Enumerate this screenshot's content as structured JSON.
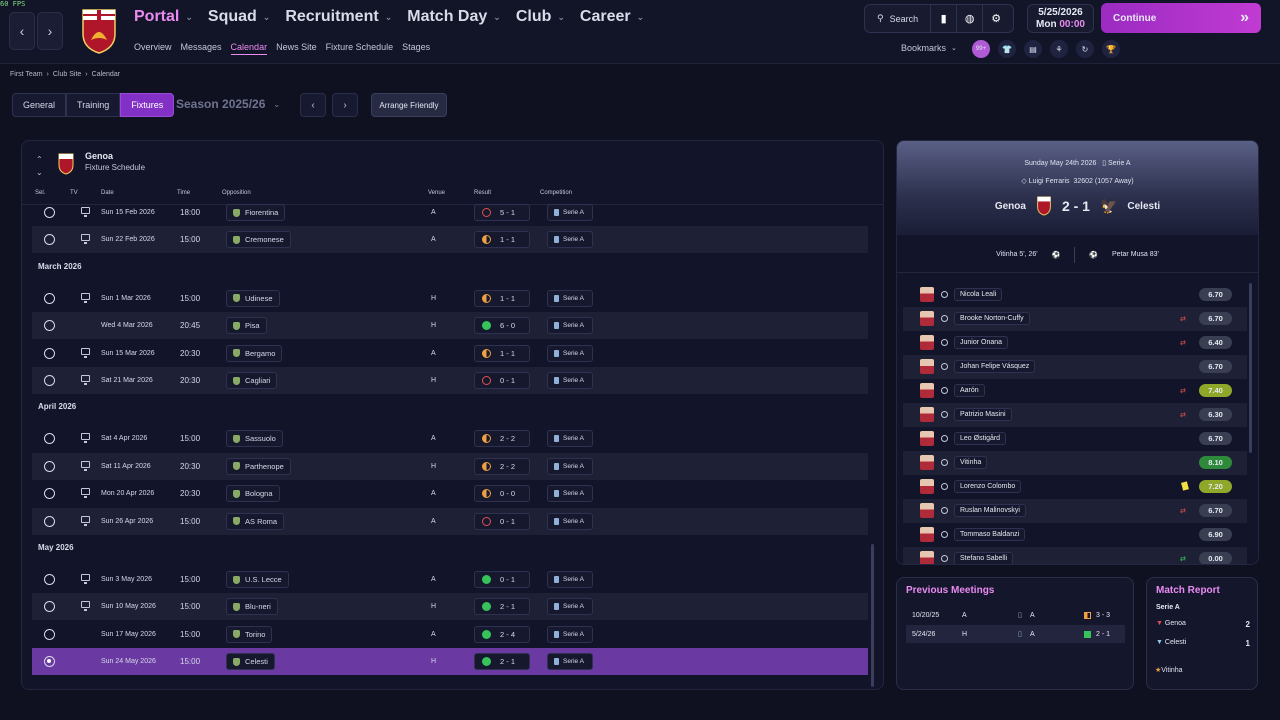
{
  "fps": "60 FPS",
  "nav": {
    "main": [
      "Portal",
      "Squad",
      "Recruitment",
      "Match Day",
      "Club",
      "Career"
    ],
    "sub": [
      "Overview",
      "Messages",
      "Calendar",
      "News Site",
      "Fixture Schedule",
      "Stages"
    ]
  },
  "tools": {
    "search": "Search"
  },
  "date": {
    "date": "5/25/2026",
    "day": "Mon",
    "time": "00:00"
  },
  "continue": "Continue",
  "bookmarks": "Bookmarks",
  "badge": "99+",
  "breadcrumb": [
    "First Team",
    "Club Site",
    "Calendar"
  ],
  "tabs": [
    "General",
    "Training",
    "Fixtures"
  ],
  "season": "Season 2025/26",
  "arrange": "Arrange Friendly",
  "schedule": {
    "club": "Genoa",
    "title": "Fixture Schedule",
    "columns": [
      "Sel.",
      "TV",
      "Date",
      "Time",
      "Opposition",
      "Venue",
      "Result",
      "Competition"
    ],
    "groups": [
      {
        "month": "",
        "rows": [
          {
            "date": "Sun 15 Feb 2026",
            "time": "18:00",
            "opp": "Fiorentina",
            "venue": "A",
            "result": "5 - 1",
            "dot": "L",
            "comp": "Serie A",
            "tv": true
          },
          {
            "date": "Sun 22 Feb 2026",
            "time": "15:00",
            "opp": "Cremonese",
            "venue": "A",
            "result": "1 - 1",
            "dot": "D",
            "comp": "Serie A",
            "tv": true
          }
        ]
      },
      {
        "month": "March 2026",
        "rows": [
          {
            "date": "Sun 1 Mar 2026",
            "time": "15:00",
            "opp": "Udinese",
            "venue": "H",
            "result": "1 - 1",
            "dot": "D",
            "comp": "Serie A",
            "tv": true
          },
          {
            "date": "Wed 4 Mar 2026",
            "time": "20:45",
            "opp": "Pisa",
            "venue": "H",
            "result": "6 - 0",
            "dot": "W",
            "comp": "Serie A",
            "tv": false
          },
          {
            "date": "Sun 15 Mar 2026",
            "time": "20:30",
            "opp": "Bergamo",
            "venue": "A",
            "result": "1 - 1",
            "dot": "D",
            "comp": "Serie A",
            "tv": true
          },
          {
            "date": "Sat 21 Mar 2026",
            "time": "20:30",
            "opp": "Cagliari",
            "venue": "H",
            "result": "0 - 1",
            "dot": "L",
            "comp": "Serie A",
            "tv": true
          }
        ]
      },
      {
        "month": "April 2026",
        "rows": [
          {
            "date": "Sat 4 Apr 2026",
            "time": "15:00",
            "opp": "Sassuolo",
            "venue": "A",
            "result": "2 - 2",
            "dot": "D",
            "comp": "Serie A",
            "tv": true
          },
          {
            "date": "Sat 11 Apr 2026",
            "time": "20:30",
            "opp": "Parthenope",
            "venue": "H",
            "result": "2 - 2",
            "dot": "D",
            "comp": "Serie A",
            "tv": true
          },
          {
            "date": "Mon 20 Apr 2026",
            "time": "20:30",
            "opp": "Bologna",
            "venue": "A",
            "result": "0 - 0",
            "dot": "D",
            "comp": "Serie A",
            "tv": true
          },
          {
            "date": "Sun 26 Apr 2026",
            "time": "15:00",
            "opp": "AS Roma",
            "venue": "A",
            "result": "0 - 1",
            "dot": "L",
            "comp": "Serie A",
            "tv": true
          }
        ]
      },
      {
        "month": "May 2026",
        "rows": [
          {
            "date": "Sun 3 May 2026",
            "time": "15:00",
            "opp": "U.S. Lecce",
            "venue": "A",
            "result": "0 - 1",
            "dot": "W",
            "comp": "Serie A",
            "tv": true
          },
          {
            "date": "Sun 10 May 2026",
            "time": "15:00",
            "opp": "Blu-neri",
            "venue": "H",
            "result": "2 - 1",
            "dot": "W",
            "comp": "Serie A",
            "tv": true
          },
          {
            "date": "Sun 17 May 2026",
            "time": "15:00",
            "opp": "Torino",
            "venue": "A",
            "result": "2 - 4",
            "dot": "W",
            "comp": "Serie A",
            "tv": false
          },
          {
            "date": "Sun 24 May 2026",
            "time": "15:00",
            "opp": "Celesti",
            "venue": "H",
            "result": "2 - 1",
            "dot": "W",
            "comp": "Serie A",
            "tv": false,
            "selected": true
          }
        ]
      }
    ]
  },
  "match": {
    "line1": "Sunday May 24th 2026",
    "competition": "Serie A",
    "stadium": "Luigi Ferraris",
    "attendance": "32602",
    "away": "(1057 Away)",
    "home_team": "Genoa",
    "away_team": "Celesti",
    "score": "2 - 1",
    "scorer1": "Vitinha 5', 26'",
    "scorer2": "Petar Musa 83'",
    "players": [
      {
        "name": "Nicola Leali",
        "rating": "6.70",
        "sub": ""
      },
      {
        "name": "Brooke Norton-Cuffy",
        "rating": "6.70",
        "sub": "off"
      },
      {
        "name": "Junior Onana",
        "rating": "6.40",
        "sub": "off"
      },
      {
        "name": "Johan Felipe Vásquez",
        "rating": "6.70",
        "sub": ""
      },
      {
        "name": "Aarón",
        "rating": "7.40",
        "sub": "off",
        "cls": "good"
      },
      {
        "name": "Patrizio Masini",
        "rating": "6.30",
        "sub": "off"
      },
      {
        "name": "Leo Østigård",
        "rating": "6.70",
        "sub": ""
      },
      {
        "name": "Vitinha",
        "rating": "8.10",
        "sub": "",
        "cls": "great"
      },
      {
        "name": "Lorenzo Colombo",
        "rating": "7.20",
        "sub": "yellow",
        "cls": "good"
      },
      {
        "name": "Ruslan Malinovskyi",
        "rating": "6.70",
        "sub": "off"
      },
      {
        "name": "Tommaso Baldanzi",
        "rating": "6.90",
        "sub": ""
      },
      {
        "name": "Stefano Sabelli",
        "rating": "0.00",
        "sub": "on"
      }
    ]
  },
  "previous": {
    "title": "Previous Meetings",
    "rows": [
      {
        "date": "10/20/25",
        "venue": "A",
        "comp": "A",
        "result": "3 - 3",
        "dot": "D"
      },
      {
        "date": "5/24/26",
        "venue": "H",
        "comp": "A",
        "result": "2 - 1",
        "dot": "W"
      }
    ]
  },
  "report": {
    "title": "Match Report",
    "competition": "Serie A",
    "home": "Genoa",
    "home_score": "2",
    "away": "Celesti",
    "away_score": "1",
    "motm": "Vitinha"
  }
}
